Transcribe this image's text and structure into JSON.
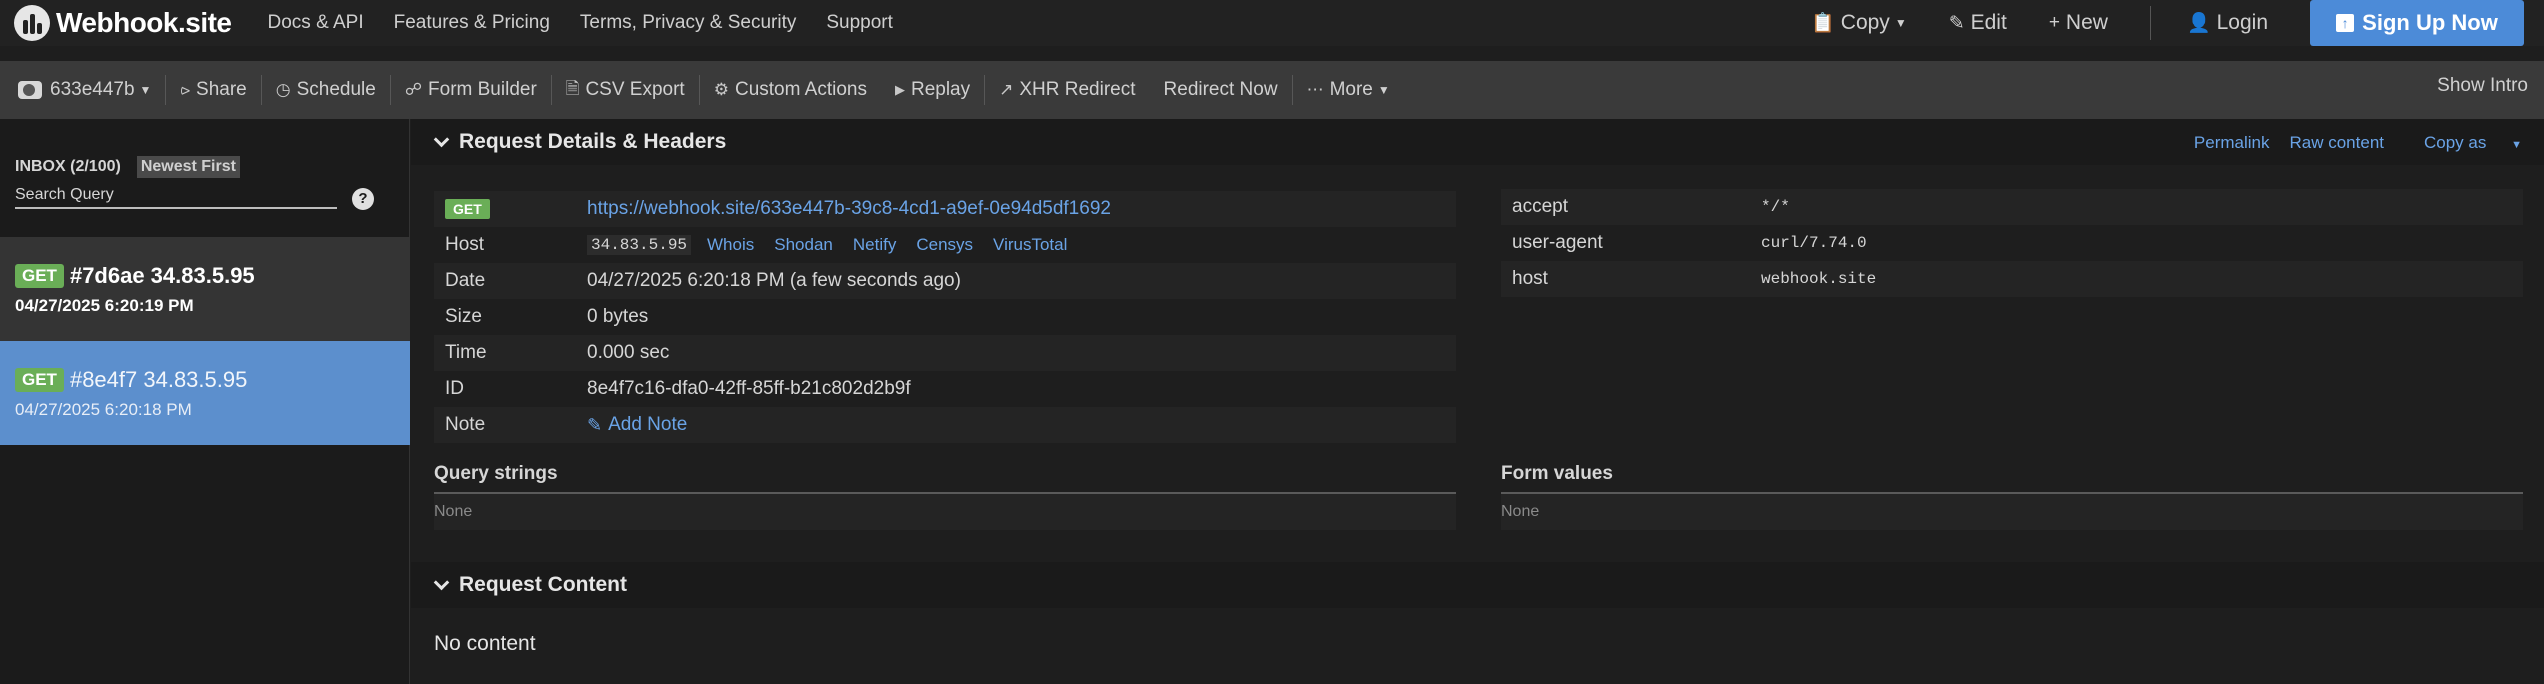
{
  "topnav": {
    "brand": "Webhook.site",
    "links": [
      "Docs & API",
      "Features & Pricing",
      "Terms, Privacy & Security",
      "Support"
    ],
    "copy_label": "Copy",
    "edit_label": "Edit",
    "new_label": "New",
    "login_label": "Login",
    "signup_label": "Sign Up Now"
  },
  "toolbar": {
    "token": "633e447b",
    "share": "Share",
    "schedule": "Schedule",
    "form_builder": "Form Builder",
    "csv_export": "CSV Export",
    "custom_actions": "Custom Actions",
    "replay": "Replay",
    "xhr_redirect": "XHR Redirect",
    "redirect_now": "Redirect Now",
    "more": "More",
    "show_intro": "Show Intro"
  },
  "sidebar": {
    "inbox_label": "INBOX (2/100)",
    "sort_label": "Newest First",
    "search_placeholder": "Search Query",
    "help": "?",
    "requests": [
      {
        "method": "GET",
        "title": "#7d6ae 34.83.5.95",
        "time": "04/27/2025 6:20:19 PM"
      },
      {
        "method": "GET",
        "title": "#8e4f7 34.83.5.95",
        "time": "04/27/2025 6:20:18 PM"
      }
    ]
  },
  "details_section": {
    "title": "Request Details & Headers",
    "links": [
      "Permalink",
      "Raw content",
      "Copy as"
    ],
    "method": "GET",
    "url": "https://webhook.site/633e447b-39c8-4cd1-a9ef-0e94d5df1692",
    "host_label": "Host",
    "host_value": "34.83.5.95",
    "host_links": [
      "Whois",
      "Shodan",
      "Netify",
      "Censys",
      "VirusTotal"
    ],
    "date_label": "Date",
    "date_value": "04/27/2025 6:20:18 PM (a few seconds ago)",
    "size_label": "Size",
    "size_value": "0 bytes",
    "time_label": "Time",
    "time_value": "0.000 sec",
    "id_label": "ID",
    "id_value": "8e4f7c16-dfa0-42ff-85ff-b21c802d2b9f",
    "note_label": "Note",
    "note_action": "Add Note",
    "headers": [
      {
        "key": "accept",
        "value": "*/*"
      },
      {
        "key": "user-agent",
        "value": "curl/7.74.0"
      },
      {
        "key": "host",
        "value": "webhook.site"
      }
    ],
    "query_strings_title": "Query strings",
    "query_strings_value": "None",
    "form_values_title": "Form values",
    "form_values_value": "None"
  },
  "content_section": {
    "title": "Request Content",
    "body": "No content"
  }
}
